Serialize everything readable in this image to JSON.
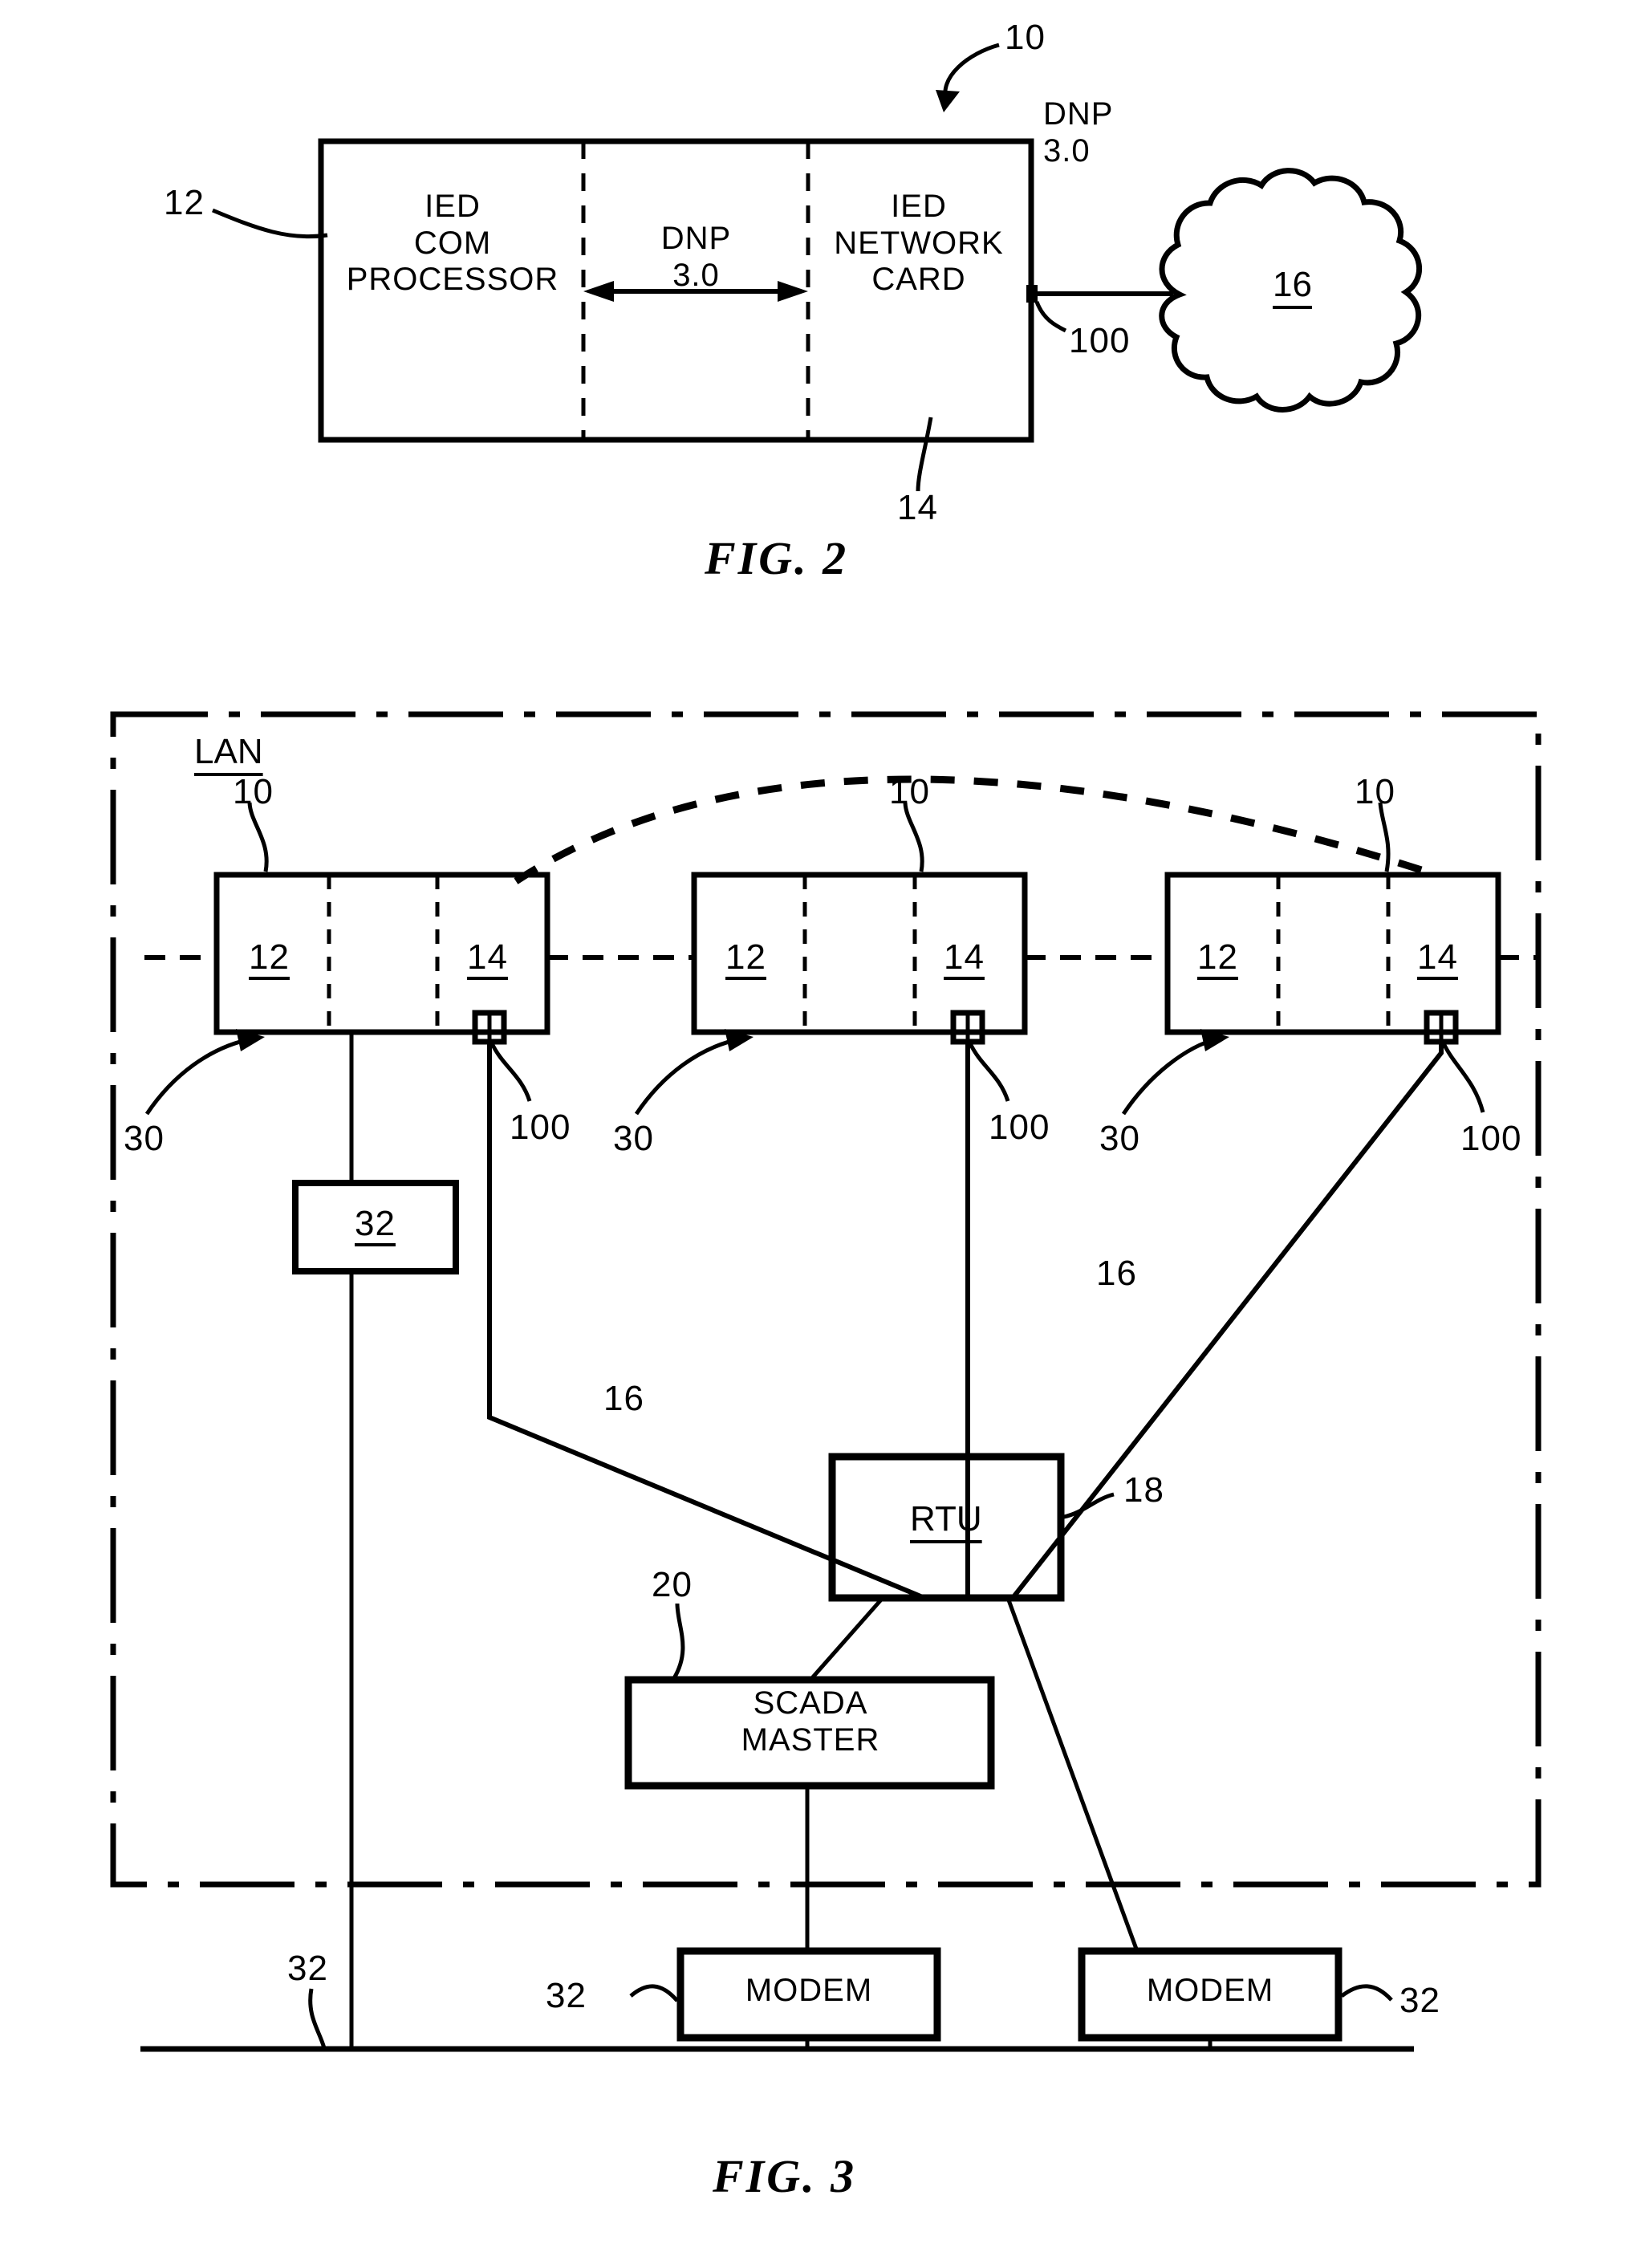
{
  "figure2": {
    "caption": "FIG.  2",
    "device": {
      "ref": "10",
      "blocks": [
        {
          "label": "IED\nCOM\nPROCESSOR",
          "ref": "12"
        },
        {
          "label": "DNP\n3.0"
        },
        {
          "label": "IED\nNETWORK\nCARD",
          "ref": "14"
        }
      ]
    },
    "link": {
      "protocol_label": "DNP\n3.0",
      "connector_ref": "100"
    },
    "cloud": {
      "ref": "16"
    }
  },
  "figure3": {
    "caption": "FIG.  3",
    "lan_label": "LAN",
    "ieds": [
      {
        "ref": "10",
        "com_ref": "12",
        "card_ref": "14",
        "callout": "30",
        "connector_ref": "100"
      },
      {
        "ref": "10",
        "com_ref": "12",
        "card_ref": "14",
        "callout": "30",
        "connector_ref": "100"
      },
      {
        "ref": "10",
        "com_ref": "12",
        "card_ref": "14",
        "callout": "30",
        "connector_ref": "100"
      }
    ],
    "nodes": {
      "device32": {
        "label": "32"
      },
      "rtu": {
        "label": "RTU",
        "ref": "18"
      },
      "scada": {
        "label": "SCADA\nMASTER",
        "ref": "20"
      },
      "modem_left": {
        "label": "MODEM",
        "ref": "32"
      },
      "modem_right": {
        "label": "MODEM",
        "ref": "32"
      },
      "bus_ref": "32"
    },
    "network_refs": [
      "16",
      "16"
    ]
  },
  "colors": {
    "ink": "#000000",
    "paper": "#ffffff"
  }
}
